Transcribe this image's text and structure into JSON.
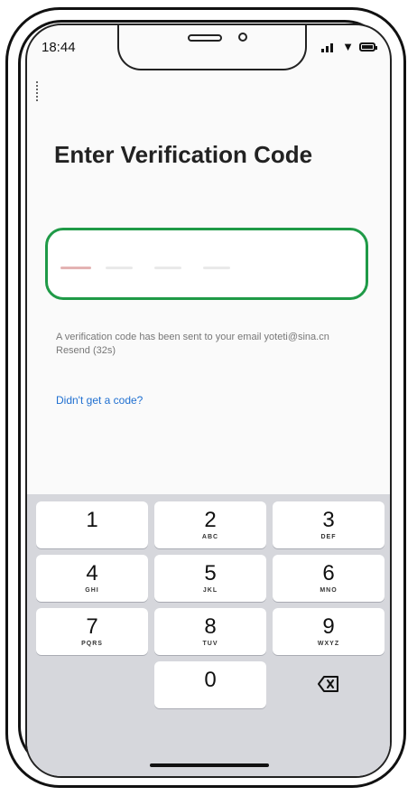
{
  "status_bar": {
    "time": "18:44"
  },
  "title": "Enter Verification Code",
  "info_text": "A verification code has been sent to your email yoteti@sina.cn  Resend (32s)",
  "help_link": "Didn't get a code?",
  "keypad": [
    {
      "num": "1",
      "letters": ""
    },
    {
      "num": "2",
      "letters": "ABC"
    },
    {
      "num": "3",
      "letters": "DEF"
    },
    {
      "num": "4",
      "letters": "GHI"
    },
    {
      "num": "5",
      "letters": "JKL"
    },
    {
      "num": "6",
      "letters": "MNO"
    },
    {
      "num": "7",
      "letters": "PQRS"
    },
    {
      "num": "8",
      "letters": "TUV"
    },
    {
      "num": "9",
      "letters": "WXYZ"
    },
    {
      "num": "0",
      "letters": ""
    }
  ],
  "icons": [
    "signal-icon",
    "wifi-icon",
    "battery-icon",
    "backspace-icon"
  ],
  "colors": {
    "accent_border": "#1f9a47",
    "link": "#1f6fd0",
    "keypad_bg": "#d6d7dc"
  }
}
